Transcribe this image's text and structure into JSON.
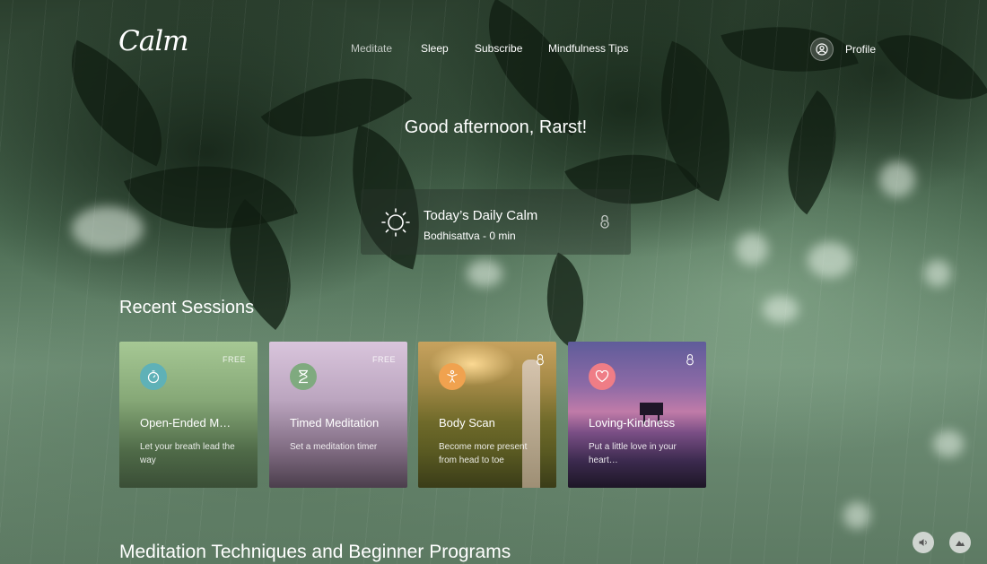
{
  "brand": {
    "logo": "Calm"
  },
  "nav": {
    "items": [
      {
        "label": "Meditate",
        "active": true
      },
      {
        "label": "Sleep"
      },
      {
        "label": "Subscribe"
      },
      {
        "label": "Mindfulness Tips"
      }
    ],
    "profile_label": "Profile"
  },
  "greeting": "Good afternoon, Rarst!",
  "daily_calm": {
    "title": "Today’s Daily Calm",
    "subtitle": "Bodhisattva - 0 min",
    "icon": "sun-icon",
    "locked": true
  },
  "recent": {
    "title": "Recent Sessions",
    "cards": [
      {
        "title": "Open-Ended M…",
        "desc": "Let your breath lead the way",
        "badge": "FREE",
        "icon": "stopwatch-icon",
        "icon_bg": "#5fb1b7"
      },
      {
        "title": "Timed Meditation",
        "desc": "Set a meditation timer",
        "badge": "FREE",
        "icon": "hourglass-icon",
        "icon_bg": "#7faa7f"
      },
      {
        "title": "Body Scan",
        "desc": "Become more present from head to toe",
        "locked": true,
        "icon": "person-icon",
        "icon_bg": "#f0a24f"
      },
      {
        "title": "Loving-Kindness",
        "desc": "Put a little love in your heart…",
        "locked": true,
        "icon": "heart-icon",
        "icon_bg": "#ef7d86"
      }
    ]
  },
  "techniques": {
    "title": "Meditation Techniques and Beginner Programs"
  },
  "controls": {
    "sound_icon": "speaker-icon",
    "scene_icon": "mountain-icon"
  }
}
